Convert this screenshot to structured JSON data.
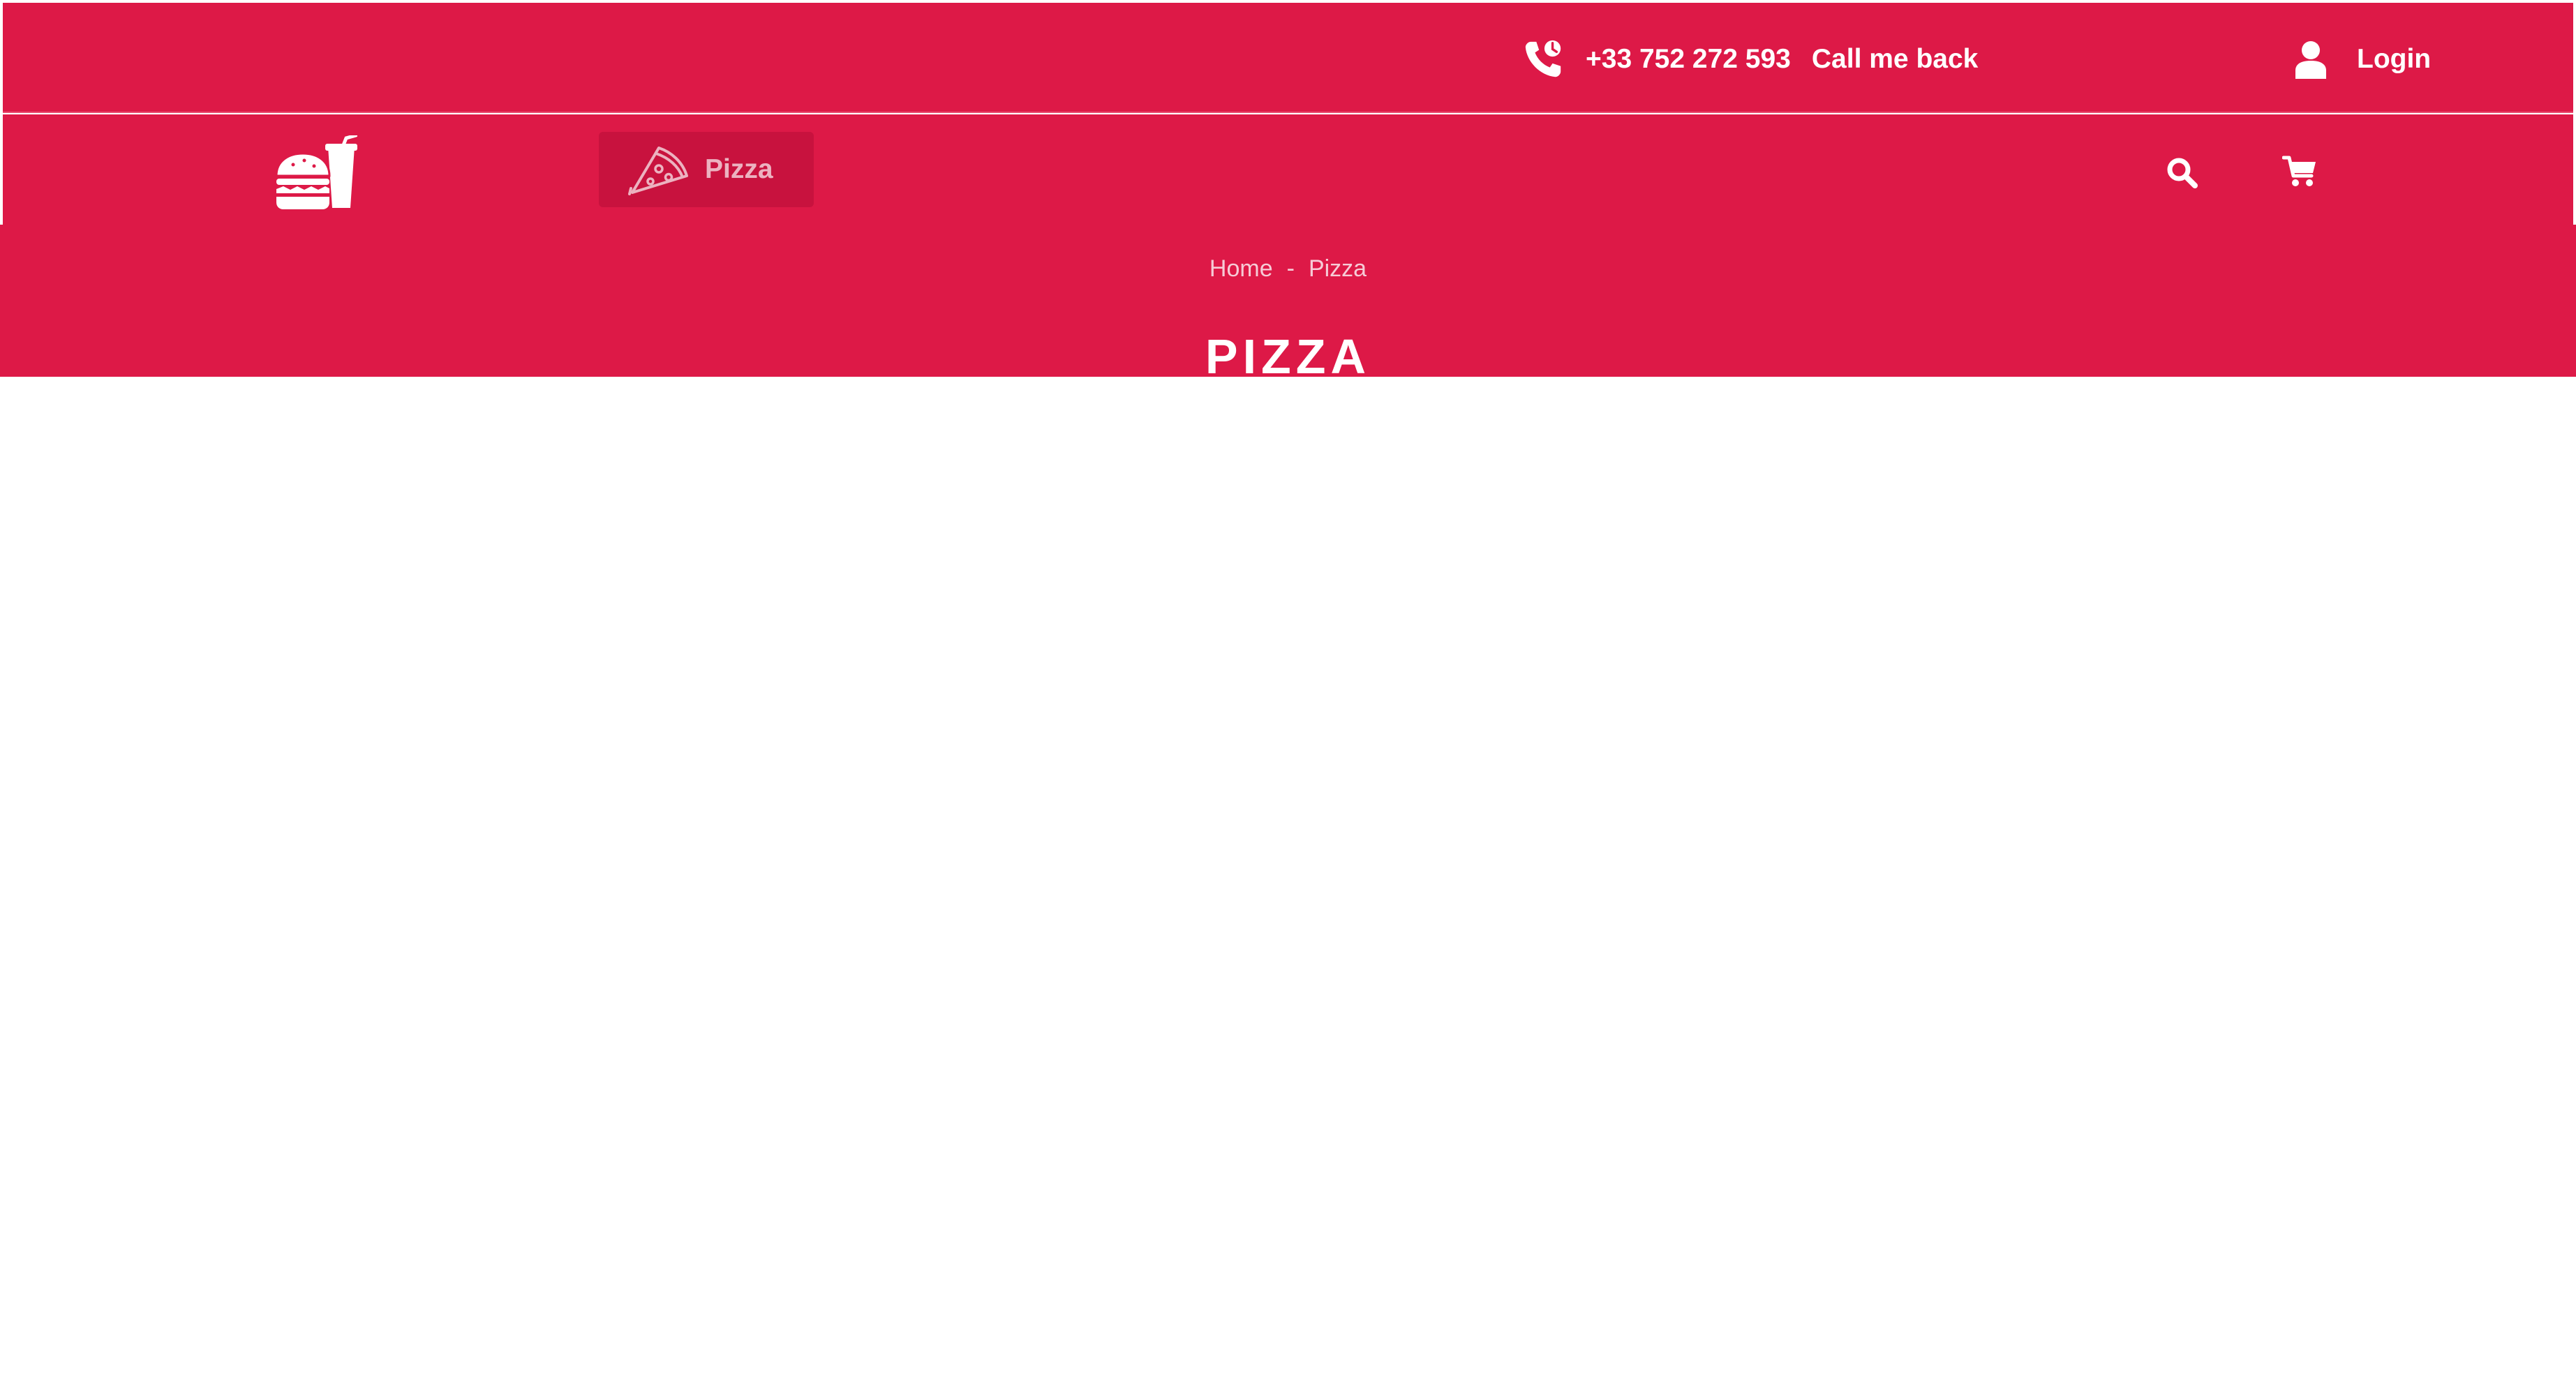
{
  "colors": {
    "brand_red": "#dd1947",
    "menu_active_bg": "#c8123e",
    "text_white": "#ffffff"
  },
  "top_bar": {
    "phone_icon": "phone-callback-icon",
    "phone_number": "+33 752 272 593",
    "call_me_back": "Call me back",
    "login_icon": "user-icon",
    "login_label": "Login"
  },
  "nav": {
    "logo_icon": "burger-drink-icon",
    "menu": [
      {
        "icon": "pizza-slice-icon",
        "label": "Pizza",
        "active": true
      }
    ],
    "search_icon": "search-icon",
    "cart_icon": "cart-icon"
  },
  "hero": {
    "breadcrumb": {
      "home": "Home",
      "separator": "-",
      "current": "Pizza"
    },
    "title": "PIZZA"
  }
}
